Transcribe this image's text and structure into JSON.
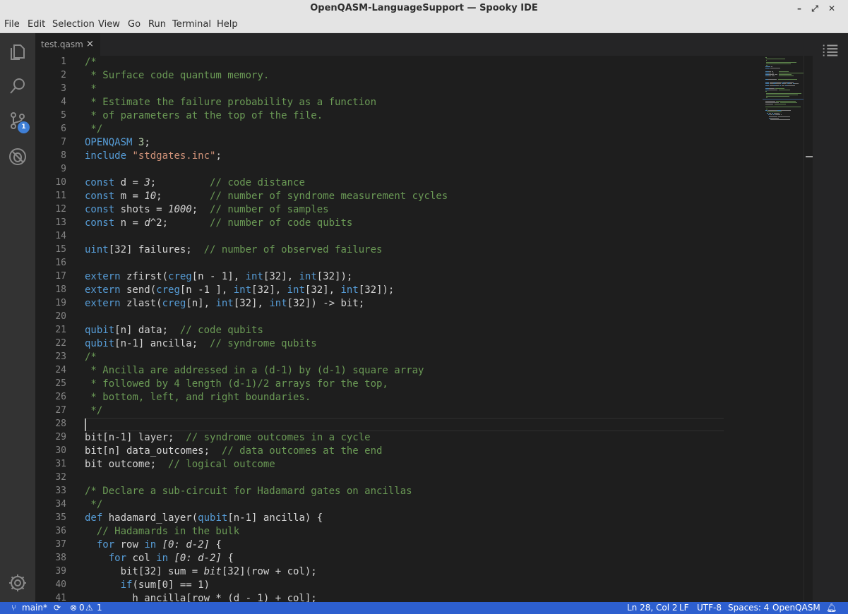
{
  "window": {
    "title": "OpenQASM-LanguageSupport — Spooky IDE"
  },
  "menu": [
    "File",
    "Edit",
    "Selection",
    "View",
    "Go",
    "Run",
    "Terminal",
    "Help"
  ],
  "activity": {
    "scm_badge": "1"
  },
  "tab": {
    "name": "test.qasm",
    "close": "×"
  },
  "status": {
    "branch": "main*",
    "errors": "0",
    "warnings": "1",
    "position": "Ln 28, Col 2",
    "eol": "LF",
    "encoding": "UTF-8",
    "spaces": "Spaces: 4",
    "language": "OpenQASM"
  },
  "editor": {
    "cursor_line": 28,
    "line_numbers": [
      "1",
      "2",
      "3",
      "4",
      "5",
      "6",
      "7",
      "8",
      "9",
      "10",
      "11",
      "12",
      "13",
      "14",
      "15",
      "16",
      "17",
      "18",
      "19",
      "20",
      "21",
      "22",
      "23",
      "24",
      "25",
      "26",
      "27",
      "28",
      "29",
      "30",
      "31",
      "32",
      "33",
      "34",
      "35",
      "36",
      "37",
      "38",
      "39",
      "40",
      "41"
    ],
    "lines": [
      [
        [
          "c",
          "/*"
        ]
      ],
      [
        [
          "c",
          " * Surface code quantum memory."
        ]
      ],
      [
        [
          "c",
          " *"
        ]
      ],
      [
        [
          "c",
          " * Estimate the failure probability as a function"
        ]
      ],
      [
        [
          "c",
          " * of parameters at the top of the file."
        ]
      ],
      [
        [
          "c",
          " */"
        ]
      ],
      [
        [
          "k",
          "OPENQASM"
        ],
        [
          "p",
          " "
        ],
        [
          "n",
          "3"
        ],
        [
          "p",
          ";"
        ]
      ],
      [
        [
          "k",
          "include"
        ],
        [
          "p",
          " "
        ],
        [
          "s",
          "\"stdgates.inc\""
        ],
        [
          "p",
          ";"
        ]
      ],
      [],
      [
        [
          "k",
          "const"
        ],
        [
          "p",
          " d = "
        ],
        [
          "i",
          "3"
        ],
        [
          "p",
          ";         "
        ],
        [
          "c",
          "// code distance"
        ]
      ],
      [
        [
          "k",
          "const"
        ],
        [
          "p",
          " m = "
        ],
        [
          "i",
          "10"
        ],
        [
          "p",
          ";        "
        ],
        [
          "c",
          "// number of syndrome measurement cycles"
        ]
      ],
      [
        [
          "k",
          "const"
        ],
        [
          "p",
          " shots = "
        ],
        [
          "i",
          "1000"
        ],
        [
          "p",
          ";  "
        ],
        [
          "c",
          "// number of samples"
        ]
      ],
      [
        [
          "k",
          "const"
        ],
        [
          "p",
          " n = "
        ],
        [
          "i",
          "d"
        ],
        [
          "p",
          "^2;       "
        ],
        [
          "c",
          "// number of code qubits"
        ]
      ],
      [],
      [
        [
          "k",
          "uint"
        ],
        [
          "p",
          "[32] failures;  "
        ],
        [
          "c",
          "// number of observed failures"
        ]
      ],
      [],
      [
        [
          "k",
          "extern"
        ],
        [
          "p",
          " zfirst("
        ],
        [
          "k",
          "creg"
        ],
        [
          "p",
          "[n - 1], "
        ],
        [
          "k",
          "int"
        ],
        [
          "p",
          "[32], "
        ],
        [
          "k",
          "int"
        ],
        [
          "p",
          "[32]);"
        ]
      ],
      [
        [
          "k",
          "extern"
        ],
        [
          "p",
          " send("
        ],
        [
          "k",
          "creg"
        ],
        [
          "p",
          "[n -1 ], "
        ],
        [
          "k",
          "int"
        ],
        [
          "p",
          "[32], "
        ],
        [
          "k",
          "int"
        ],
        [
          "p",
          "[32], "
        ],
        [
          "k",
          "int"
        ],
        [
          "p",
          "[32]);"
        ]
      ],
      [
        [
          "k",
          "extern"
        ],
        [
          "p",
          " zlast("
        ],
        [
          "k",
          "creg"
        ],
        [
          "p",
          "[n], "
        ],
        [
          "k",
          "int"
        ],
        [
          "p",
          "[32], "
        ],
        [
          "k",
          "int"
        ],
        [
          "p",
          "[32]) -> bit;"
        ]
      ],
      [],
      [
        [
          "k",
          "qubit"
        ],
        [
          "p",
          "[n] data;  "
        ],
        [
          "c",
          "// code qubits"
        ]
      ],
      [
        [
          "k",
          "qubit"
        ],
        [
          "p",
          "[n-1] ancilla;  "
        ],
        [
          "c",
          "// syndrome qubits"
        ]
      ],
      [
        [
          "c",
          "/*"
        ]
      ],
      [
        [
          "c",
          " * Ancilla are addressed in a (d-1) by (d-1) square array"
        ]
      ],
      [
        [
          "c",
          " * followed by 4 length (d-1)/2 arrays for the top,"
        ]
      ],
      [
        [
          "c",
          " * bottom, left, and right boundaries."
        ]
      ],
      [
        [
          "c",
          " */"
        ]
      ],
      [],
      [
        [
          "p",
          "bit[n-1] layer;  "
        ],
        [
          "c",
          "// syndrome outcomes in a cycle"
        ]
      ],
      [
        [
          "p",
          "bit[n] data_outcomes;  "
        ],
        [
          "c",
          "// data outcomes at the end"
        ]
      ],
      [
        [
          "p",
          "bit outcome;  "
        ],
        [
          "c",
          "// logical outcome"
        ]
      ],
      [],
      [
        [
          "c",
          "/* Declare a sub-circuit for Hadamard gates on ancillas"
        ]
      ],
      [
        [
          "c",
          " */"
        ]
      ],
      [
        [
          "k",
          "def"
        ],
        [
          "p",
          " hadamard_layer("
        ],
        [
          "k",
          "qubit"
        ],
        [
          "p",
          "[n-1] ancilla) {"
        ]
      ],
      [
        [
          "p",
          "  "
        ],
        [
          "c",
          "// Hadamards in the bulk"
        ]
      ],
      [
        [
          "p",
          "  "
        ],
        [
          "k",
          "for"
        ],
        [
          "p",
          " row "
        ],
        [
          "k",
          "in"
        ],
        [
          "p",
          " "
        ],
        [
          "i",
          "[0: d-2]"
        ],
        [
          "p",
          " {"
        ]
      ],
      [
        [
          "p",
          "    "
        ],
        [
          "k",
          "for"
        ],
        [
          "p",
          " col "
        ],
        [
          "k",
          "in"
        ],
        [
          "p",
          " "
        ],
        [
          "i",
          "[0: d-2]"
        ],
        [
          "p",
          " {"
        ]
      ],
      [
        [
          "p",
          "      bit[32] sum = "
        ],
        [
          "i",
          "bit"
        ],
        [
          "p",
          "[32](row + col);"
        ]
      ],
      [
        [
          "p",
          "      "
        ],
        [
          "k",
          "if"
        ],
        [
          "p",
          "(sum[0] == 1)"
        ]
      ],
      [
        [
          "p",
          "        h ancilla[row * (d - 1) + col];"
        ]
      ]
    ]
  }
}
